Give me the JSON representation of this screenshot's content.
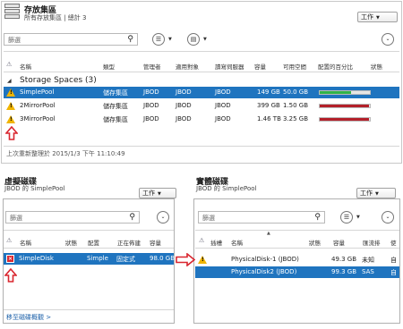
{
  "top": {
    "title": "存放集區",
    "subtitle": "所有存放集區 | 總計 3",
    "tasks_label": "工作",
    "filter_placeholder": "篩選",
    "columns": [
      "名稱",
      "類型",
      "管理者",
      "適用對象",
      "讀寫伺服器",
      "容量",
      "可用空間",
      "配置的百分比",
      "狀態"
    ],
    "group_label": "Storage Spaces (3)",
    "rows": [
      {
        "name": "SimplePool",
        "type": "儲存集區",
        "managed": "JBOD",
        "avail": "JBOD",
        "rw": "JBOD",
        "capacity": "149 GB",
        "free": "50.0 GB",
        "allocated_pct": 0.62,
        "bar_color": "#2fb34a",
        "selected": true,
        "warning": true
      },
      {
        "name": "2MirrorPool",
        "type": "儲存集區",
        "managed": "JBOD",
        "avail": "JBOD",
        "rw": "JBOD",
        "capacity": "399 GB",
        "free": "1.50 GB",
        "allocated_pct": 0.99,
        "bar_color": "#b3202a",
        "selected": false,
        "warning": true
      },
      {
        "name": "3MirrorPool",
        "type": "儲存集區",
        "managed": "JBOD",
        "avail": "JBOD",
        "rw": "JBOD",
        "capacity": "1.46 TB",
        "free": "3.25 GB",
        "allocated_pct": 0.99,
        "bar_color": "#b3202a",
        "selected": false,
        "warning": true
      }
    ],
    "last_refresh": "上次重新整理於 2015/1/3 下午 11:10:49"
  },
  "left": {
    "title": "虛擬磁碟",
    "subtitle": "JBOD 的 SimplePool",
    "tasks_label": "工作",
    "filter_placeholder": "篩選",
    "columns": [
      "名稱",
      "狀態",
      "配置",
      "正在佈建",
      "容量"
    ],
    "rows": [
      {
        "name": "SimpleDisk",
        "layout": "Simple",
        "provisioning": "固定式",
        "capacity": "98.0 GB",
        "selected": true,
        "error": true
      }
    ],
    "footer_link": "移至磁碟概觀 >"
  },
  "right": {
    "title": "實體磁碟",
    "subtitle": "JBOD 的 SimplePool",
    "tasks_label": "工作",
    "filter_placeholder": "篩選",
    "columns": [
      "插槽",
      "名稱",
      "狀態",
      "容量",
      "匯流排",
      "使"
    ],
    "rows": [
      {
        "name": "PhysicalDisk-1 (JBOD)",
        "capacity": "49.3 GB",
        "bus": "未知",
        "usage": "自",
        "selected": false,
        "warning": true
      },
      {
        "name": "PhysicalDisk2 (JBOD)",
        "capacity": "99.3 GB",
        "bus": "SAS",
        "usage": "自",
        "selected": true,
        "warning": false
      }
    ]
  },
  "colors": {
    "selection": "#1f74bf",
    "arrow": "#d9262f",
    "warning": "#f0b400"
  }
}
